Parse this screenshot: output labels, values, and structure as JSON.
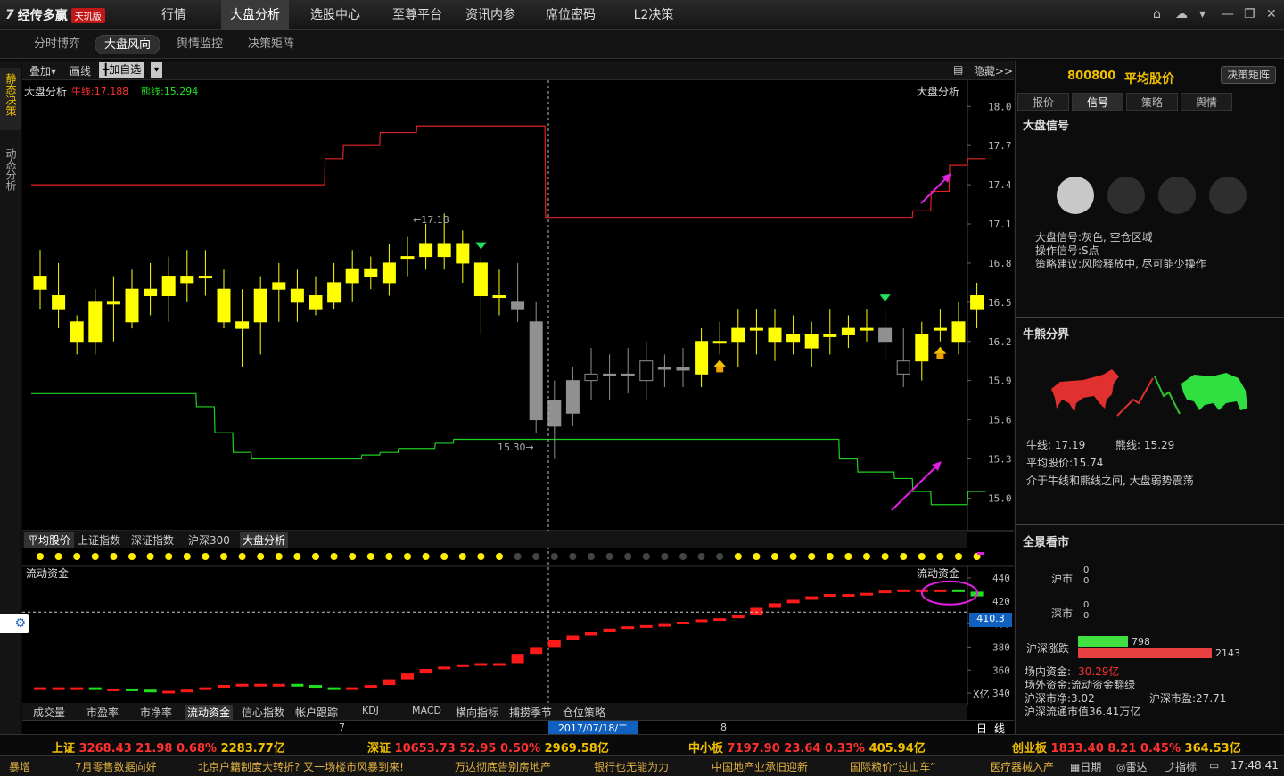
{
  "app": {
    "brand": "经传多赢",
    "edition": "天玑版"
  },
  "topnav": [
    "行情",
    "大盘分析",
    "选股中心",
    "至尊平台",
    "资讯内参",
    "席位密码",
    "L2决策"
  ],
  "subtabs": [
    "分时博弈",
    "大盘风向",
    "舆情监控",
    "决策矩阵"
  ],
  "left_tabs": [
    "静态决策",
    "动态分析"
  ],
  "toolbar": {
    "overlay": "叠加▾",
    "draw": "画线",
    "add_watch": "╋加自选",
    "hide": "隐藏>>"
  },
  "main_chart": {
    "title": "大盘分析",
    "bull_label": "牛线:17.188",
    "bear_label": "熊线:15.294",
    "title_right": "大盘分析",
    "yticks": [
      "18.0",
      "17.7",
      "17.4",
      "17.1",
      "16.8",
      "16.5",
      "16.2",
      "15.9",
      "15.6",
      "15.3",
      "15.0"
    ],
    "high_mark": "←17.18",
    "low_mark": "15.30→",
    "colors": {
      "bull": "#e02020",
      "bear": "#20d020",
      "up_candle": "#ffff00",
      "gray_candle": "#909090",
      "arrow": "#e020e0"
    }
  },
  "index_tabs": [
    "平均股价",
    "上证指数",
    "深证指数",
    "沪深300",
    "大盘分析"
  ],
  "flow_chart": {
    "label": "流动资金",
    "label_right": "流动资金",
    "yticks": [
      "440",
      "420",
      "400",
      "380",
      "360",
      "340"
    ],
    "cursor_value": "410.3",
    "unit": "X亿"
  },
  "bottom_tabs": [
    "成交量",
    "市盈率",
    "市净率",
    "流动资金",
    "信心指数",
    "帐户跟踪",
    "KDJ",
    "MACD",
    "横向指标",
    "捕捞季节",
    "仓位策略"
  ],
  "date_axis": {
    "left": "7",
    "cursor": "2017/07/18/二",
    "right": "8",
    "mode": "日",
    "line": "线"
  },
  "right": {
    "code": "800800",
    "name": "平均股价",
    "matrix_btn": "决策矩阵",
    "tabs": [
      "报价",
      "信号",
      "策略",
      "舆情"
    ],
    "signal_title": "大盘信号",
    "signal_lines": [
      "大盘信号:灰色, 空仓区域",
      "操作信号:S点",
      "策略建议:风险释放中, 尽可能少操作"
    ],
    "bullbear_title": "牛熊分界",
    "bull_line": "牛线: 17.19",
    "bear_line": "熊线: 15.29",
    "avg_price": "平均股价:15.74",
    "comment": "介于牛线和熊线之间, 大盘弱势震荡",
    "overview_title": "全景看市",
    "sh_label": "沪市",
    "sz_label": "深市",
    "sh_vals": [
      "0",
      "0"
    ],
    "sz_vals": [
      "0",
      "0"
    ],
    "updown_label": "沪深涨跌",
    "up_count": "798",
    "down_count": "2143",
    "fund_in": "场内资金:",
    "fund_in_val": "30.29亿",
    "fund_out": "场外资金:流动资金翻绿",
    "net_label": "沪深市净:3.02",
    "pe_label": "沪深市盈:27.71",
    "mktcap": "沪深流通市值36.41万亿"
  },
  "ticker": [
    {
      "name": "上证",
      "price": "3268.43",
      "chg": "21.98",
      "pct": "0.68%",
      "amt": "2283.77亿"
    },
    {
      "name": "深证",
      "price": "10653.73",
      "chg": "52.95",
      "pct": "0.50%",
      "amt": "2969.58亿"
    },
    {
      "name": "中小板",
      "price": "7197.90",
      "chg": "23.64",
      "pct": "0.33%",
      "amt": "405.94亿"
    },
    {
      "name": "创业板",
      "price": "1833.40",
      "chg": "8.21",
      "pct": "0.45%",
      "amt": "364.53亿"
    }
  ],
  "news": [
    "暴增",
    "7月零售数据向好",
    "北京户籍制度大转折? 又一场楼市风暴到来!",
    "万达彻底告别房地产",
    "银行也无能为力",
    "中国地产业承旧迎新",
    "国际粮价“过山车”",
    "医疗器械入产"
  ],
  "status": {
    "calendar": "日期",
    "radar": "雷达",
    "indicator": "指标",
    "time": "17:48:41"
  },
  "chart_data": {
    "type": "candlestick",
    "candles": [
      [
        16.7,
        16.6,
        16.9,
        16.45
      ],
      [
        16.55,
        16.45,
        16.8,
        16.3
      ],
      [
        16.35,
        16.2,
        16.4,
        16.1
      ],
      [
        16.2,
        16.5,
        16.6,
        16.1
      ],
      [
        16.5,
        16.5,
        16.7,
        16.2
      ],
      [
        16.35,
        16.6,
        16.75,
        16.3
      ],
      [
        16.55,
        16.6,
        16.8,
        16.4
      ],
      [
        16.55,
        16.7,
        16.85,
        16.35
      ],
      [
        16.65,
        16.7,
        16.9,
        16.5
      ],
      [
        16.7,
        16.7,
        16.9,
        16.55
      ],
      [
        16.6,
        16.35,
        16.75,
        16.3
      ],
      [
        16.35,
        16.3,
        16.6,
        16.0
      ],
      [
        16.35,
        16.6,
        16.7,
        16.1
      ],
      [
        16.6,
        16.65,
        16.8,
        16.35
      ],
      [
        16.6,
        16.5,
        16.75,
        16.35
      ],
      [
        16.45,
        16.55,
        16.7,
        16.4
      ],
      [
        16.5,
        16.65,
        16.8,
        16.45
      ],
      [
        16.65,
        16.75,
        16.9,
        16.5
      ],
      [
        16.7,
        16.75,
        16.85,
        16.6
      ],
      [
        16.65,
        16.8,
        16.95,
        16.55
      ],
      [
        16.85,
        16.85,
        17.0,
        16.7
      ],
      [
        16.85,
        16.95,
        17.1,
        16.75
      ],
      [
        16.85,
        16.95,
        17.18,
        16.75
      ],
      [
        16.95,
        16.8,
        17.05,
        16.65
      ],
      [
        16.8,
        16.55,
        16.85,
        16.25
      ],
      [
        16.55,
        16.55,
        16.75,
        16.4
      ],
      [
        16.5,
        16.45,
        16.8,
        16.35
      ],
      [
        16.35,
        15.6,
        16.5,
        15.5
      ],
      [
        15.75,
        15.55,
        15.9,
        15.3
      ],
      [
        15.9,
        15.65,
        16.0,
        15.55
      ],
      [
        15.9,
        15.95,
        16.15,
        15.75
      ],
      [
        15.95,
        15.95,
        16.1,
        15.75
      ],
      [
        15.95,
        15.95,
        16.15,
        15.8
      ],
      [
        15.9,
        16.05,
        16.2,
        15.75
      ],
      [
        16.0,
        16.0,
        16.1,
        15.85
      ],
      [
        16.0,
        15.98,
        16.15,
        15.85
      ],
      [
        15.95,
        16.2,
        16.3,
        15.85
      ],
      [
        16.2,
        16.2,
        16.35,
        16.1
      ],
      [
        16.2,
        16.3,
        16.45,
        16.0
      ],
      [
        16.3,
        16.3,
        16.45,
        16.1
      ],
      [
        16.3,
        16.2,
        16.45,
        16.05
      ],
      [
        16.25,
        16.2,
        16.4,
        16.1
      ],
      [
        16.15,
        16.25,
        16.35,
        16.0
      ],
      [
        16.25,
        16.25,
        16.45,
        16.1
      ],
      [
        16.25,
        16.3,
        16.4,
        16.15
      ],
      [
        16.3,
        16.3,
        16.45,
        16.2
      ],
      [
        16.3,
        16.2,
        16.45,
        16.05
      ],
      [
        15.95,
        16.05,
        16.3,
        15.85
      ],
      [
        16.05,
        16.25,
        16.35,
        15.9
      ],
      [
        16.3,
        16.3,
        16.45,
        16.2
      ],
      [
        16.2,
        16.35,
        16.5,
        16.1
      ],
      [
        16.45,
        16.55,
        16.65,
        16.3
      ]
    ],
    "bull_line": [
      17.4,
      17.4,
      17.4,
      17.4,
      17.4,
      17.4,
      17.4,
      17.4,
      17.4,
      17.4,
      17.4,
      17.4,
      17.4,
      17.4,
      17.4,
      17.4,
      17.6,
      17.7,
      17.7,
      17.8,
      17.8,
      17.85,
      17.85,
      17.85,
      17.85,
      17.85,
      17.85,
      17.85,
      17.15,
      17.15,
      17.15,
      17.15,
      17.15,
      17.15,
      17.15,
      17.15,
      17.15,
      17.15,
      17.15,
      17.15,
      17.15,
      17.15,
      17.15,
      17.15,
      17.15,
      17.15,
      17.15,
      17.15,
      17.2,
      17.35,
      17.55,
      17.6
    ],
    "bear_line": [
      15.8,
      15.8,
      15.8,
      15.8,
      15.8,
      15.8,
      15.8,
      15.8,
      15.8,
      15.7,
      15.5,
      15.35,
      15.3,
      15.3,
      15.3,
      15.3,
      15.3,
      15.3,
      15.33,
      15.35,
      15.38,
      15.38,
      15.42,
      15.45,
      15.45,
      15.45,
      15.45,
      15.45,
      15.45,
      15.45,
      15.45,
      15.45,
      15.45,
      15.45,
      15.45,
      15.45,
      15.45,
      15.45,
      15.45,
      15.45,
      15.45,
      15.45,
      15.45,
      15.45,
      15.3,
      15.2,
      15.2,
      15.15,
      15.05,
      14.95,
      14.95,
      15.05
    ],
    "flow": [
      345,
      345,
      345,
      344,
      344,
      343,
      342,
      342,
      343,
      345,
      347,
      348,
      348,
      348,
      347,
      345,
      344,
      345,
      347,
      352,
      357,
      361,
      363,
      365,
      366,
      366,
      374,
      380,
      386,
      390,
      393,
      396,
      398,
      399,
      400,
      402,
      404,
      405,
      408,
      414,
      418,
      421,
      424,
      426,
      426,
      427,
      429,
      430,
      430,
      430,
      428,
      424
    ]
  }
}
